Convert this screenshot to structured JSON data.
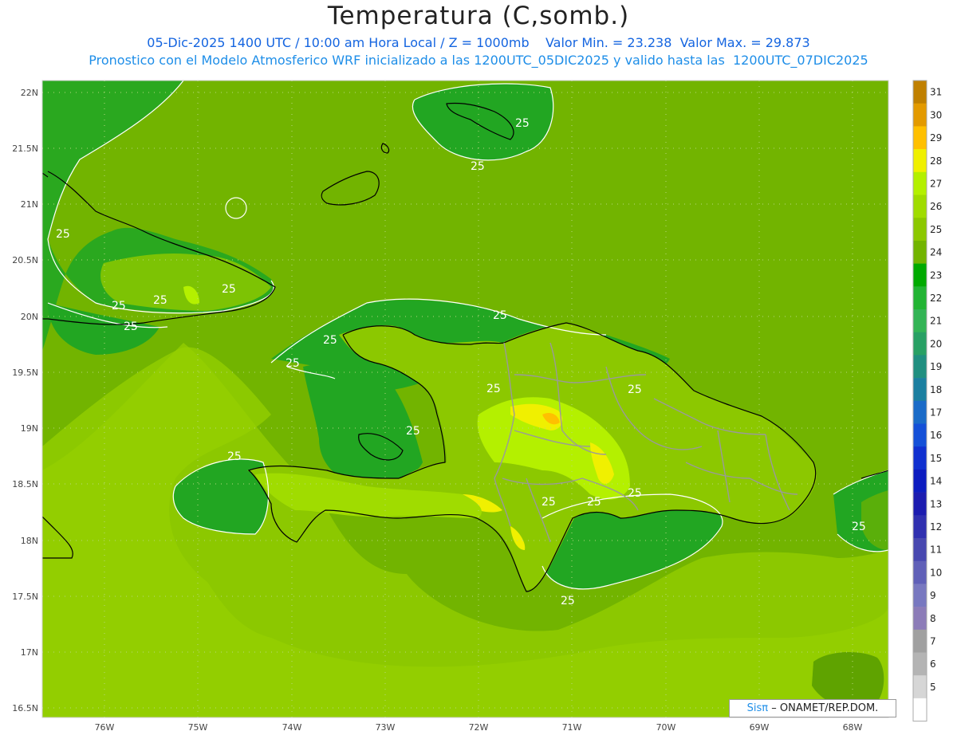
{
  "header": {
    "title": "Temperatura (C,somb.)",
    "line1": "05-Dic-2025 1400 UTC / 10:00 am Hora Local / Z = 1000mb    Valor Min. = 23.238  Valor Max. = 29.873",
    "line2": "Pronostico con el Modelo Atmosferico WRF inicializado a las 1200UTC_05DIC2025 y valido hasta las  1200UTC_07DIC2025"
  },
  "axes": {
    "lat_labels": [
      "22N",
      "21.5N",
      "21N",
      "20.5N",
      "20N",
      "19.5N",
      "19N",
      "18.5N",
      "18N",
      "17.5N",
      "17N",
      "16.5N"
    ],
    "lon_labels": [
      "76W",
      "75W",
      "74W",
      "73W",
      "72W",
      "71W",
      "70W",
      "69W",
      "68W"
    ]
  },
  "colorbar": {
    "ticks": [
      "31",
      "30",
      "29",
      "28",
      "27",
      "26",
      "25",
      "24",
      "23",
      "22",
      "21",
      "20",
      "19",
      "18",
      "17",
      "16",
      "15",
      "14",
      "13",
      "12",
      "11",
      "10",
      "9",
      "8",
      "7",
      "6",
      "5"
    ],
    "colors": [
      "#c08000",
      "#e39a00",
      "#ffc000",
      "#f0f000",
      "#b4f000",
      "#a0dc00",
      "#8cc800",
      "#72b400",
      "#00aa00",
      "#22b433",
      "#33b455",
      "#28a064",
      "#208f80",
      "#1b7fa0",
      "#1a6bc8",
      "#1450d8",
      "#1030d0",
      "#0c1cc0",
      "#1c1cb0",
      "#3030b0",
      "#4848b0",
      "#6060b8",
      "#7878c0",
      "#8c7cb8",
      "#a0a0a0",
      "#b4b4b4",
      "#d6d6d6",
      "#ffffff"
    ]
  },
  "contour_label": "25",
  "legend": {
    "field_colors": {
      "t26": "#8cc800",
      "t25": "#72b400",
      "t24": "#22a622",
      "t27": "#b4f000",
      "t28": "#f0f000",
      "t29": "#ffc000"
    }
  },
  "credit": {
    "brand": "Sisπ",
    "text": "– ONAMET/REP.DOM."
  }
}
